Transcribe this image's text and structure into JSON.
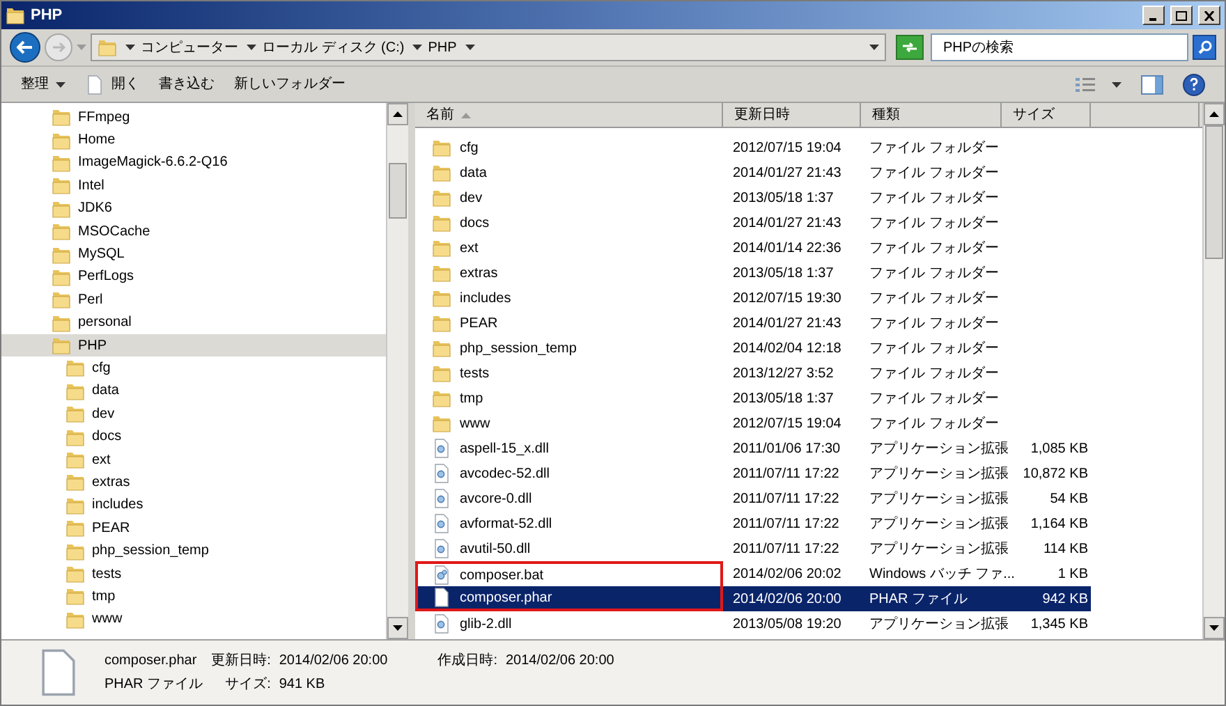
{
  "window": {
    "title": "PHP"
  },
  "address_bar": {
    "breadcrumbs": [
      "コンピューター",
      "ローカル ディスク (C:)",
      "PHP"
    ]
  },
  "search": {
    "placeholder": "PHPの検索"
  },
  "toolbar": {
    "items": [
      {
        "label": "整理",
        "kind": "menu"
      },
      {
        "label": "開く",
        "kind": "open"
      },
      {
        "label": "書き込む",
        "kind": "plain"
      },
      {
        "label": "新しいフォルダー",
        "kind": "plain"
      }
    ]
  },
  "tree": {
    "items": [
      {
        "label": "FFmpeg",
        "selected": false
      },
      {
        "label": "Home",
        "selected": false
      },
      {
        "label": "ImageMagick-6.6.2-Q16",
        "selected": false
      },
      {
        "label": "Intel",
        "selected": false
      },
      {
        "label": "JDK6",
        "selected": false
      },
      {
        "label": "MSOCache",
        "selected": false
      },
      {
        "label": "MySQL",
        "selected": false
      },
      {
        "label": "PerfLogs",
        "selected": false
      },
      {
        "label": "Perl",
        "selected": false
      },
      {
        "label": "personal",
        "selected": false
      },
      {
        "label": "PHP",
        "selected": true,
        "children": [
          {
            "label": "cfg",
            "selected": false
          },
          {
            "label": "data",
            "selected": false
          },
          {
            "label": "dev",
            "selected": false
          },
          {
            "label": "docs",
            "selected": false
          },
          {
            "label": "ext",
            "selected": false
          },
          {
            "label": "extras",
            "selected": false
          },
          {
            "label": "includes",
            "selected": false
          },
          {
            "label": "PEAR",
            "selected": false
          },
          {
            "label": "php_session_temp",
            "selected": false
          },
          {
            "label": "tests",
            "selected": false
          },
          {
            "label": "tmp",
            "selected": false
          },
          {
            "label": "www",
            "selected": false
          }
        ]
      }
    ]
  },
  "file_list": {
    "columns": [
      {
        "label": "名前",
        "sorted": true
      },
      {
        "label": "更新日時",
        "sorted": false
      },
      {
        "label": "種類",
        "sorted": false
      },
      {
        "label": "サイズ",
        "sorted": false
      }
    ],
    "rows": [
      {
        "name": "cfg",
        "date": "2012/07/15 19:04",
        "type": "ファイル フォルダー",
        "kind": "folder",
        "selected": false,
        "annotated": false
      },
      {
        "name": "data",
        "date": "2014/01/27 21:43",
        "type": "ファイル フォルダー",
        "kind": "folder",
        "selected": false,
        "annotated": false
      },
      {
        "name": "dev",
        "date": "2013/05/18 1:37",
        "type": "ファイル フォルダー",
        "kind": "folder",
        "selected": false,
        "annotated": false
      },
      {
        "name": "docs",
        "date": "2014/01/27 21:43",
        "type": "ファイル フォルダー",
        "kind": "folder",
        "selected": false,
        "annotated": false
      },
      {
        "name": "ext",
        "date": "2014/01/14 22:36",
        "type": "ファイル フォルダー",
        "kind": "folder",
        "selected": false,
        "annotated": false
      },
      {
        "name": "extras",
        "date": "2013/05/18 1:37",
        "type": "ファイル フォルダー",
        "kind": "folder",
        "selected": false,
        "annotated": false
      },
      {
        "name": "includes",
        "date": "2012/07/15 19:30",
        "type": "ファイル フォルダー",
        "kind": "folder",
        "selected": false,
        "annotated": false
      },
      {
        "name": "PEAR",
        "date": "2014/01/27 21:43",
        "type": "ファイル フォルダー",
        "kind": "folder",
        "selected": false,
        "annotated": false
      },
      {
        "name": "php_session_temp",
        "date": "2014/02/04 12:18",
        "type": "ファイル フォルダー",
        "kind": "folder",
        "selected": false,
        "annotated": false
      },
      {
        "name": "tests",
        "date": "2013/12/27 3:52",
        "type": "ファイル フォルダー",
        "kind": "folder",
        "selected": false,
        "annotated": false
      },
      {
        "name": "tmp",
        "date": "2013/05/18 1:37",
        "type": "ファイル フォルダー",
        "kind": "folder",
        "selected": false,
        "annotated": false
      },
      {
        "name": "www",
        "date": "2012/07/15 19:04",
        "type": "ファイル フォルダー",
        "kind": "folder",
        "selected": false,
        "annotated": false
      },
      {
        "name": "aspell-15_x.dll",
        "date": "2011/01/06 17:30",
        "type": "アプリケーション拡張",
        "size": "1,085 KB",
        "kind": "dll",
        "selected": false,
        "annotated": false
      },
      {
        "name": "avcodec-52.dll",
        "date": "2011/07/11 17:22",
        "type": "アプリケーション拡張",
        "size": "10,872 KB",
        "kind": "dll",
        "selected": false,
        "annotated": false
      },
      {
        "name": "avcore-0.dll",
        "date": "2011/07/11 17:22",
        "type": "アプリケーション拡張",
        "size": "54 KB",
        "kind": "dll",
        "selected": false,
        "annotated": false
      },
      {
        "name": "avformat-52.dll",
        "date": "2011/07/11 17:22",
        "type": "アプリケーション拡張",
        "size": "1,164 KB",
        "kind": "dll",
        "selected": false,
        "annotated": false
      },
      {
        "name": "avutil-50.dll",
        "date": "2011/07/11 17:22",
        "type": "アプリケーション拡張",
        "size": "114 KB",
        "kind": "dll",
        "selected": false,
        "annotated": false
      },
      {
        "name": "composer.bat",
        "date": "2014/02/06 20:02",
        "type": "Windows バッチ ファ...",
        "size": "1 KB",
        "kind": "bat",
        "selected": false,
        "annotated": true
      },
      {
        "name": "composer.phar",
        "date": "2014/02/06 20:00",
        "type": "PHAR ファイル",
        "size": "942 KB",
        "kind": "file",
        "selected": true,
        "annotated": true
      },
      {
        "name": "glib-2.dll",
        "date": "2013/05/08 19:20",
        "type": "アプリケーション拡張",
        "size": "1,345 KB",
        "kind": "dll",
        "selected": false,
        "annotated": false
      }
    ]
  },
  "details": {
    "name": "composer.phar",
    "type": "PHAR ファイル",
    "fields": [
      {
        "label": "更新日時:",
        "value": "2014/02/06 20:00"
      },
      {
        "label": "作成日時:",
        "value": "2014/02/06 20:00"
      },
      {
        "label": "サイズ:",
        "value": "941 KB"
      }
    ]
  }
}
